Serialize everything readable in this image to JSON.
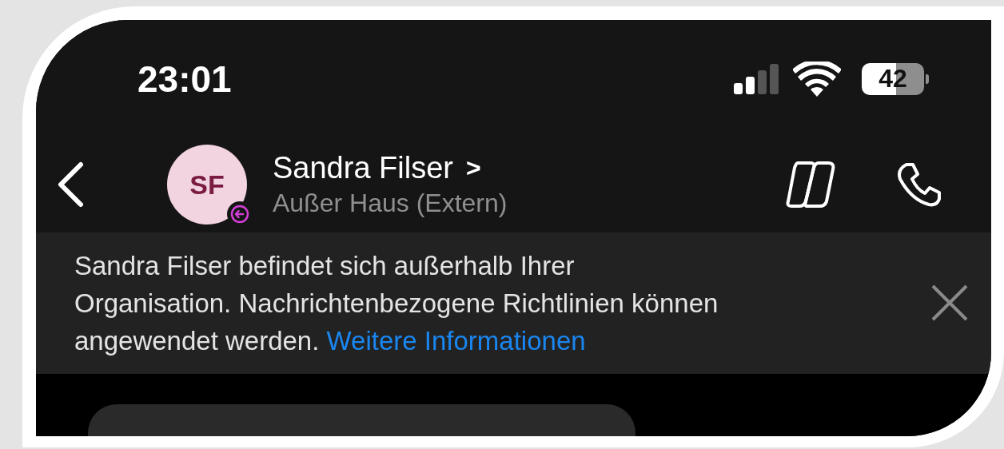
{
  "status_bar": {
    "time": "23:01",
    "battery": "42"
  },
  "header": {
    "avatar_initials": "SF",
    "name": "Sandra Filser",
    "name_chevron": ">",
    "status": "Außer Haus (Extern)"
  },
  "banner": {
    "text": "Sandra Filser befindet sich außerhalb Ihrer\nOrganisation. Nachrichtenbezogene Richtlinien können\nangewendet werden.",
    "link": "Weitere Informationen"
  }
}
